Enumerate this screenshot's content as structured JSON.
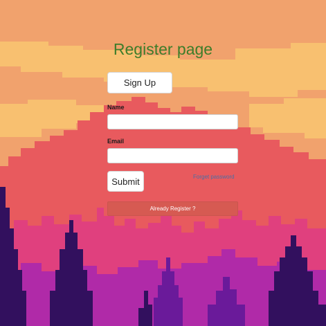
{
  "page": {
    "title": "Register page"
  },
  "buttons": {
    "signup_label": "Sign Up",
    "submit_label": "Submit",
    "already_label": "Already Register ?"
  },
  "form": {
    "name_label": "Name",
    "name_value": "",
    "email_label": "Email",
    "email_value": ""
  },
  "links": {
    "forgot_password": "Forget password"
  },
  "colors": {
    "sky": "#f1a26d",
    "cloud": "#f8c070",
    "mountain": "#e85a5e",
    "pink_trees": "#e0407e",
    "magenta": "#b02aa8",
    "purple": "#6a1a9a",
    "dark_trees": "#32105e",
    "title": "#3d7d2a",
    "already_button": "#d65a52"
  }
}
